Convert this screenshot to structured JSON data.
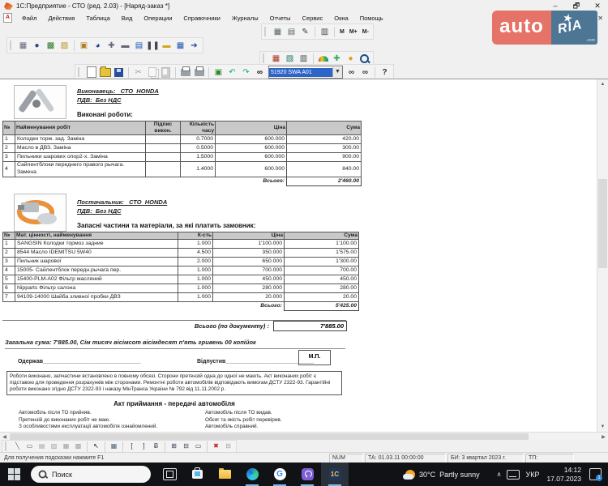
{
  "window": {
    "title": "1С:Предприятие - СТО (ред. 2.03) - [Наряд-заказ *]",
    "minimize": "–",
    "maximize": "🗗",
    "close": "✕",
    "mdi_close": "✕"
  },
  "menu": {
    "items": [
      "Файл",
      "Действия",
      "Таблица",
      "Вид",
      "Операции",
      "Справочники",
      "Журналы",
      "Отчеты",
      "Сервис",
      "Окна",
      "Помощь"
    ]
  },
  "toolbar": {
    "memory_m": "M",
    "memory_plus": "M+",
    "memory_minus": "M-",
    "part_search_value": "51920 SWA A01",
    "help_label": "?"
  },
  "watermark": {
    "auto": "auto",
    "ria": "RIA",
    "star": "★",
    "com": ".com"
  },
  "document": {
    "executor": "Виконавець:   СТО  HONDA",
    "vat1": "ПДВ:  Без НДС",
    "works_title": "Виконані роботи:",
    "works_table": {
      "headers": [
        "№",
        "Найменування робіт",
        "Підпис викон.",
        "Кількість часу",
        "Ціна",
        "Сума"
      ],
      "rows": [
        [
          "1",
          "Колодки торм. зад. Заміна",
          "",
          "0.7000",
          "600.000",
          "420.00"
        ],
        [
          "2",
          "Масло в ДВЗ. Заміна",
          "",
          "0.5000",
          "600.000",
          "300.00"
        ],
        [
          "3",
          "Пильники шарових опор2-х. Заміна",
          "",
          "1.5000",
          "600.000",
          "900.00"
        ],
        [
          "4",
          "Сайлентблоки переднего правого рычага. Замена",
          "",
          "1.4000",
          "600.000",
          "840.00"
        ]
      ],
      "total_label": "Всього:",
      "total": "2'460.00"
    },
    "supplier": "Постачальник:   СТО  HONDA",
    "vat2": "ПДВ:  Без НДС",
    "parts_title": "Запасні частини та матеріали, за які платить замовник:",
    "parts_table": {
      "headers": [
        "№",
        "Мат. цінності, найменування",
        "К-сть",
        "Ціна",
        "Сума"
      ],
      "rows": [
        [
          "1",
          "SANGSIN Колодки тормоз задние",
          "1.000",
          "1'100.000",
          "1'100.00"
        ],
        [
          "2",
          "8544 Масло IDEMITSU 5W40",
          "4.500",
          "350.000",
          "1'575.00"
        ],
        [
          "3",
          "Пильник шарової",
          "2.000",
          "650.000",
          "1'300.00"
        ],
        [
          "4",
          "15005- Сайлентблок передн.рычага пер.",
          "1.000",
          "700.000",
          "700.00"
        ],
        [
          "5",
          "15400-PLM-A02 Фільтр масляний",
          "1.000",
          "450.000",
          "450.00"
        ],
        [
          "6",
          "Nipparts Фільтр салона",
          "1.000",
          "280.000",
          "280.00"
        ],
        [
          "7",
          "94109-14000 Шайба зливної пробки ДВЗ",
          "1.000",
          "20.000",
          "20.00"
        ]
      ],
      "total_label": "Всього:",
      "total": "5'425.00"
    },
    "doc_total_label": "Всього (по документу) :",
    "doc_total": "7'885.00",
    "sum_words": "Загальна сума:  7'885.00, Сім тисяч вісімсот вісімдесят п'ять гривень 00 копійок",
    "received": "Одержав_______________________________",
    "released": "Відпустив____________________________",
    "stamp": "М.П.",
    "legal": "Роботи виконано, запчастини встановлено в повному обсязі. Сторони претензій одна до одної не мають. Акт виконаних робіт є підставою для проведення розрахунків між сторонами. Ремонтні роботи автомобілів відповідають вимогам ДСТУ 2322-93. Гарантійні роботи виконано згідно ДСТУ 2322-93 і наказу МінТранса України № 792 від 11.11.2002 р.",
    "act_title": "Акт приймання - передачі автомобіля",
    "act_left": [
      "Автомобіль після ТО прийняв.",
      "Претензій до виконаних робіт не маю.",
      "З особливостями експлуатації автомобіля ознайомлений."
    ],
    "act_right": [
      "Автомобіль після ТО видав.",
      "Обсяг та якість робіт перевірив.",
      "Автомобіль справний."
    ]
  },
  "statusbar": {
    "hint": "Для получения подсказки нажмите F1",
    "num": "NUM",
    "ta": "ТА: 01.03.11  00:00:00",
    "bi": "БИ: 3 квартал 2023 г.",
    "tp": "ТП:"
  },
  "taskbar": {
    "search": "Поиск",
    "weather_temp": "30°C",
    "weather_desc": "Partly sunny",
    "chevron": "∧",
    "lang": "УКР",
    "time": "14:12",
    "date": "17.07.2023",
    "badge": "1"
  }
}
